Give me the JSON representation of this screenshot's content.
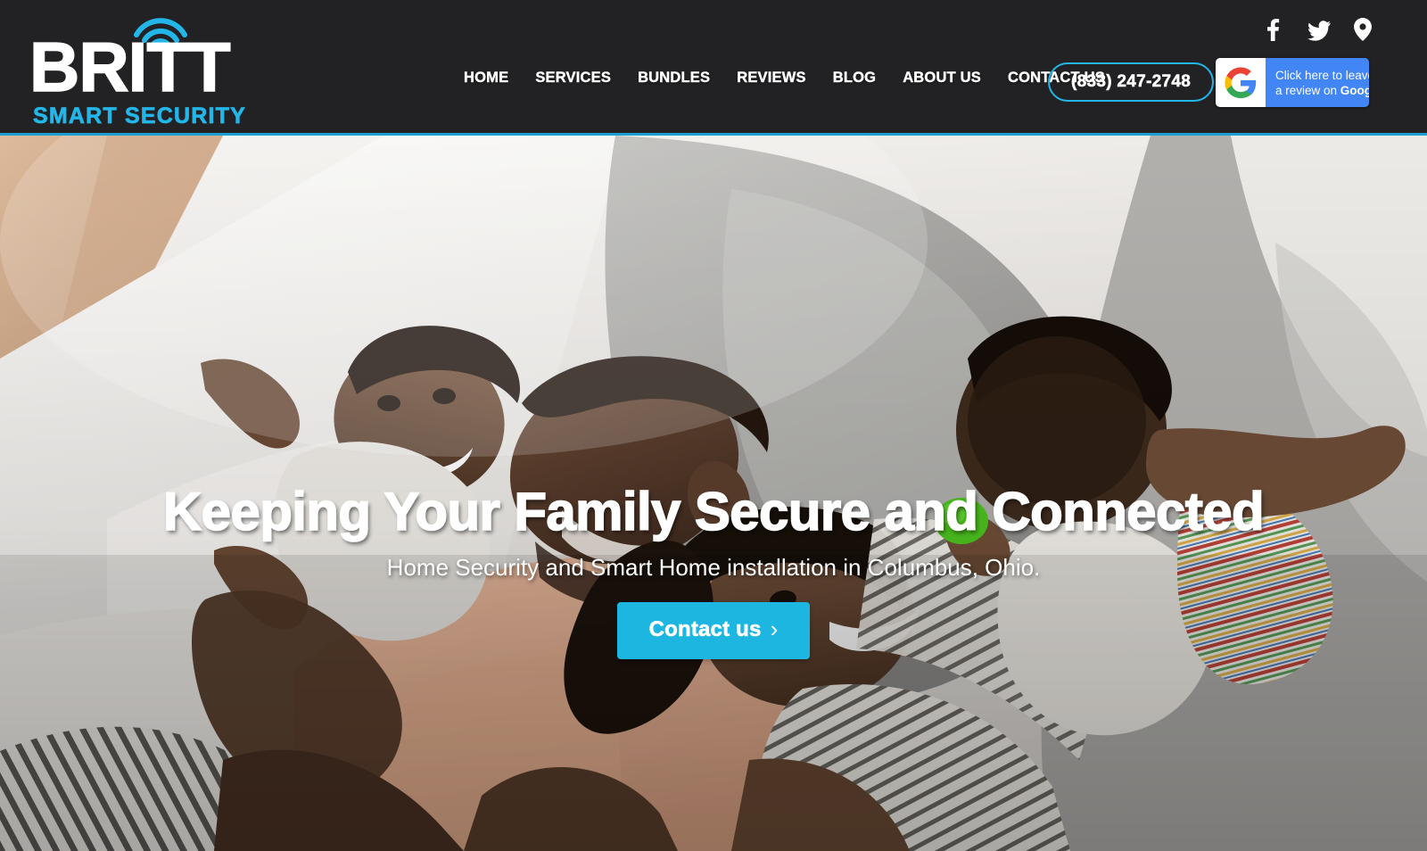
{
  "brand": {
    "name": "BRITT",
    "tagline": "SMART SECURITY",
    "accent_color": "#23b6e8",
    "header_bg": "#222224"
  },
  "header": {
    "nav": [
      {
        "label": "HOME"
      },
      {
        "label": "SERVICES"
      },
      {
        "label": "BUNDLES"
      },
      {
        "label": "REVIEWS"
      },
      {
        "label": "BLOG"
      },
      {
        "label": "ABOUT US"
      },
      {
        "label": "CONTACT US"
      }
    ],
    "phone_label": "(833) 247-2748",
    "socials": [
      {
        "name": "facebook-icon"
      },
      {
        "name": "twitter-icon"
      },
      {
        "name": "location-pin-icon"
      }
    ],
    "google_badge": {
      "line1": "Click here to leave us",
      "line2_prefix": "a review on ",
      "line2_bold": "Google!",
      "bg_color": "#4285f4"
    }
  },
  "hero": {
    "title": "Keeping Your Family Secure and Connected",
    "subtitle": "Home Security and Smart Home installation in Columbus, Ohio.",
    "cta_label": "Contact us",
    "cta_chevron": "›",
    "cta_color": "#1cb6e0"
  }
}
